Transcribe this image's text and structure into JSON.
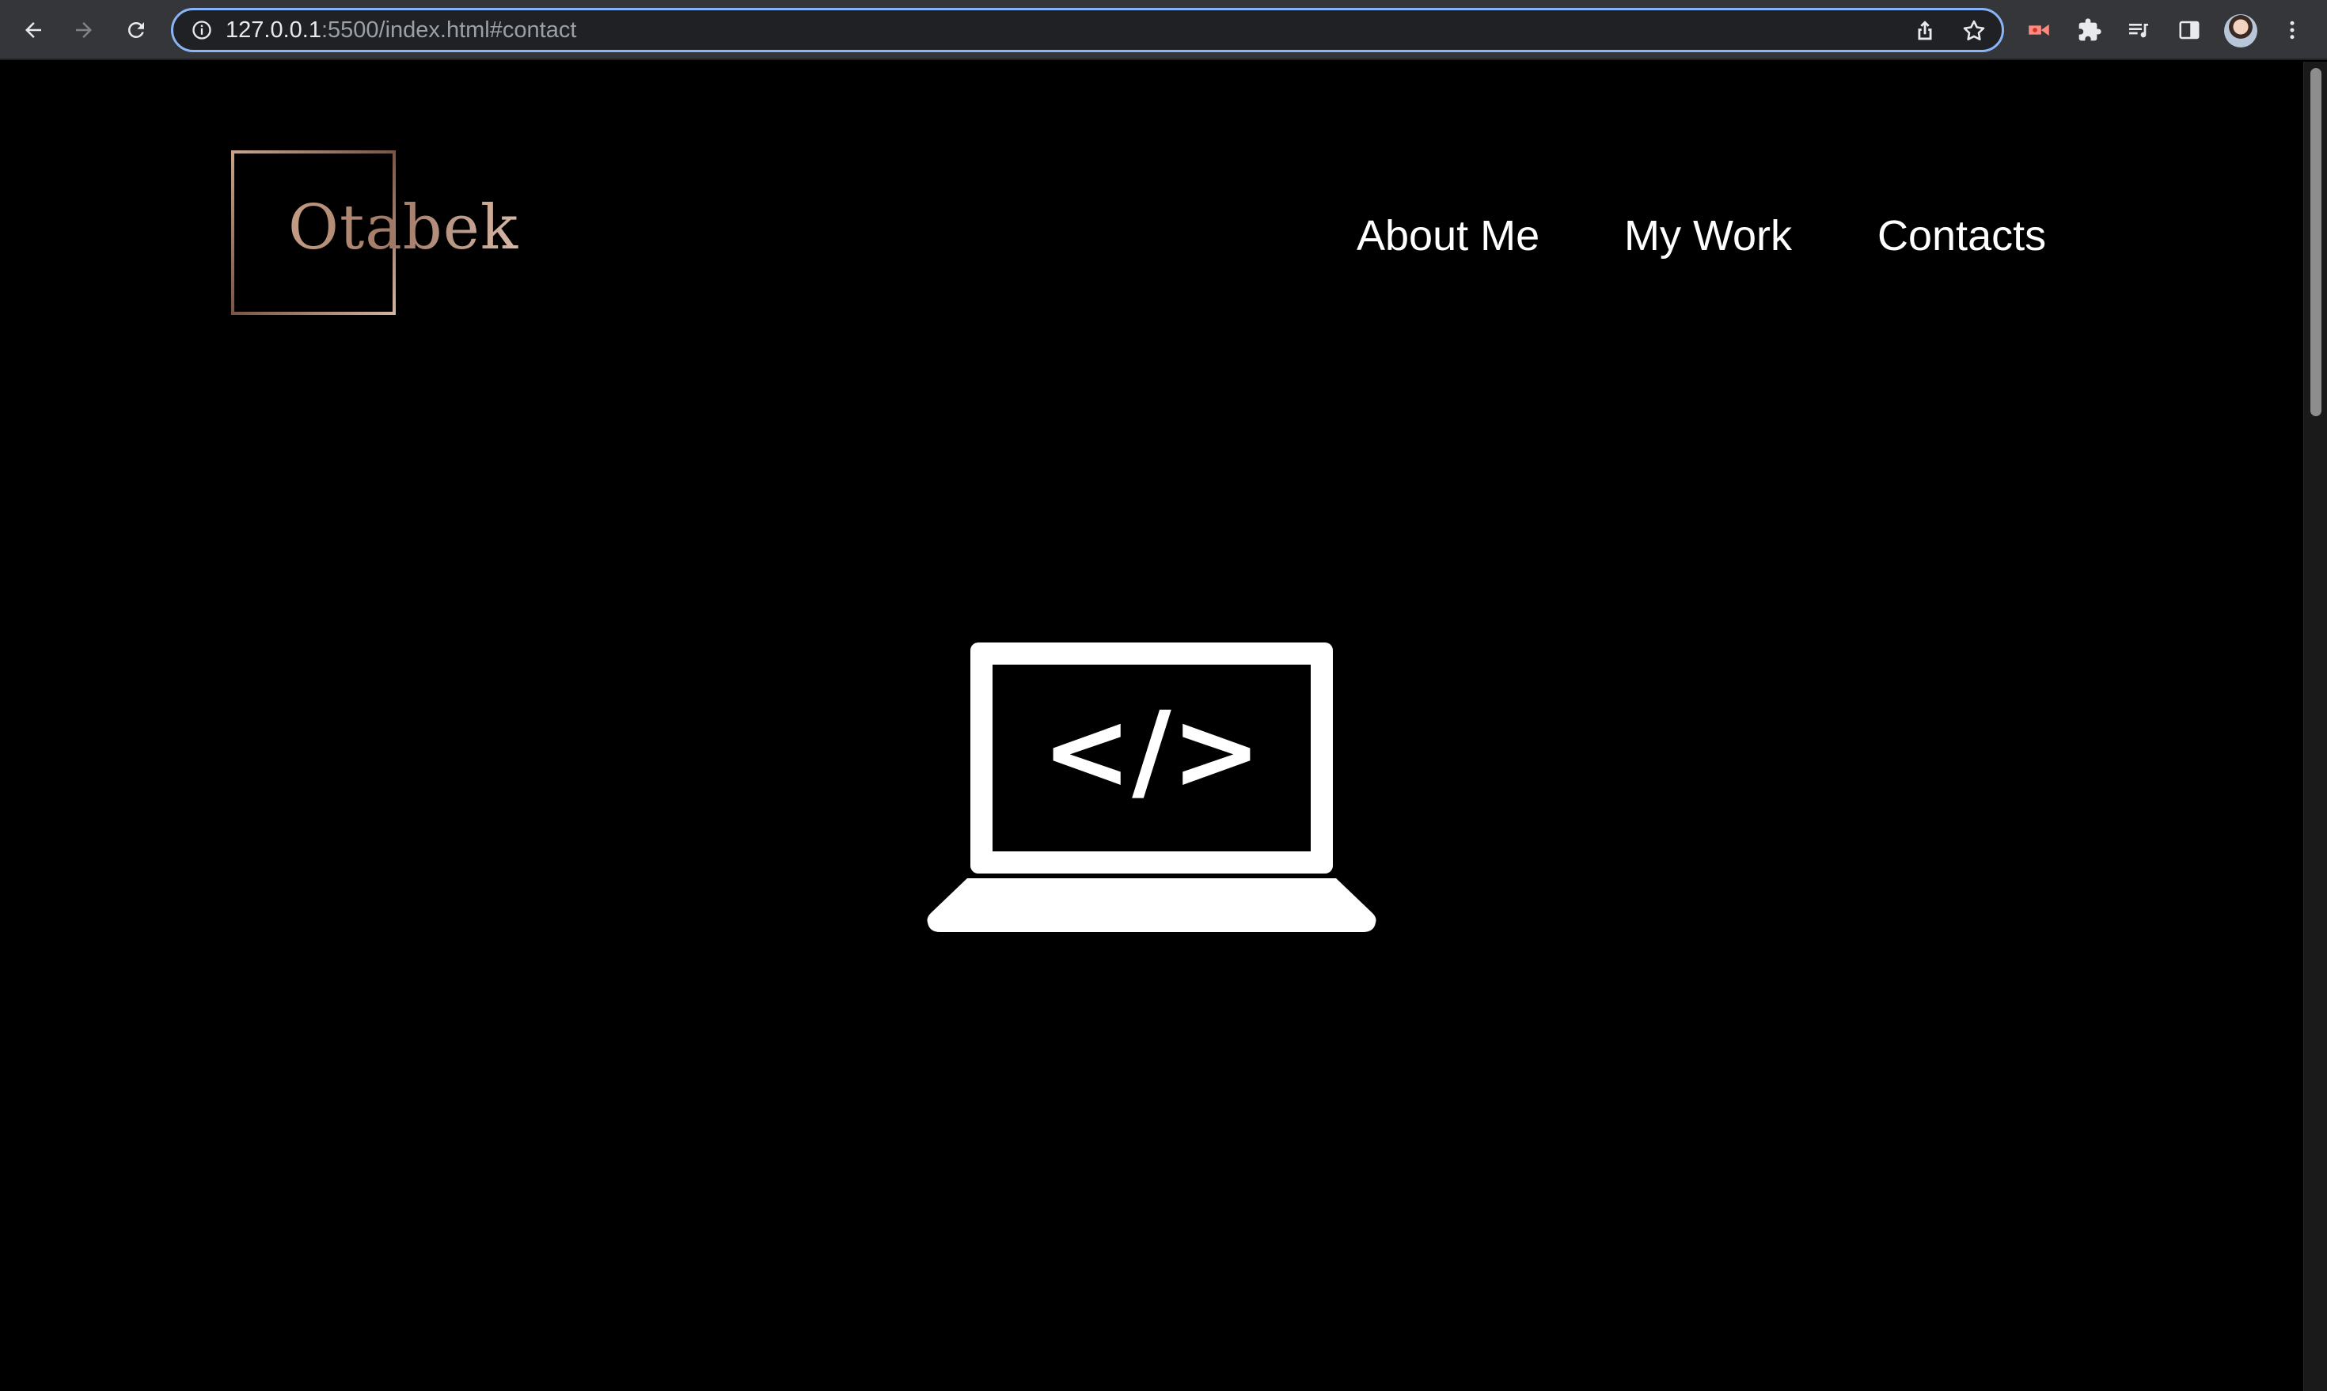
{
  "browser": {
    "url_host": "127.0.0.1",
    "url_rest": ":5500/index.html#contact",
    "icons": {
      "back": "back-arrow-icon",
      "forward": "forward-arrow-icon",
      "reload": "reload-icon",
      "info": "info-icon",
      "share": "share-icon",
      "bookmark": "star-icon",
      "extension": "puzzle-icon",
      "media": "media-queue-icon",
      "sidepanel": "side-panel-icon",
      "menu": "kebab-menu-icon"
    },
    "omnibox_focus_color": "#8ab4f8"
  },
  "site": {
    "logo_text": "Otabek",
    "logo_color": "#a27a63",
    "nav": {
      "about": "About Me",
      "work": "My Work",
      "contacts": "Contacts"
    },
    "hero_icon": "laptop-code-icon",
    "hero_code_text": "</>",
    "background": "#000000",
    "text_color": "#ffffff"
  }
}
